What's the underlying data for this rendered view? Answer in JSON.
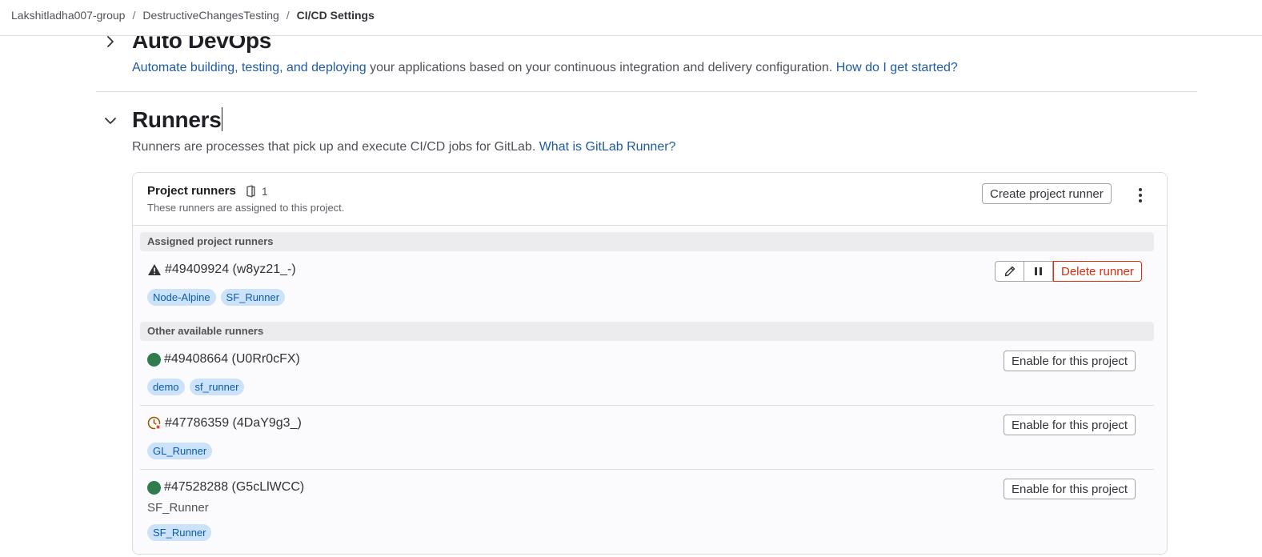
{
  "breadcrumb": {
    "items": [
      "Lakshitladha007-group",
      "DestructiveChangesTesting",
      "CI/CD Settings"
    ],
    "separator": "/"
  },
  "auto_devops": {
    "title": "Auto DevOps",
    "desc_link": "Automate building, testing, and deploying",
    "desc_text": " your applications based on your continuous integration and delivery configuration. ",
    "help_link": "How do I get started?"
  },
  "runners": {
    "title": "Runners",
    "desc_text": "Runners are processes that pick up and execute CI/CD jobs for GitLab. ",
    "help_link": "What is GitLab Runner?"
  },
  "project_runners": {
    "title": "Project runners",
    "count": "1",
    "subtitle": "These runners are assigned to this project.",
    "create_button": "Create project runner",
    "assigned_header": "Assigned project runners",
    "assigned": [
      {
        "name": "#49409924 (w8yz21_-)",
        "status": "warning-icon",
        "tags": [
          "Node-Alpine",
          "SF_Runner"
        ],
        "delete_button": "Delete runner"
      }
    ],
    "other_header": "Other available runners",
    "enable_label": "Enable for this project",
    "other": [
      {
        "name": "#49408664 (U0Rr0cFX)",
        "status": "online",
        "description": "",
        "tags": [
          "demo",
          "sf_runner"
        ]
      },
      {
        "name": "#47786359 (4DaY9g3_)",
        "status": "stale",
        "description": "",
        "tags": [
          "GL_Runner"
        ]
      },
      {
        "name": "#47528288 (G5cLlWCC)",
        "status": "online",
        "description": "SF_Runner",
        "tags": [
          "SF_Runner"
        ]
      }
    ]
  },
  "colors": {
    "link": "#1f5aa6",
    "online": "#2f7d4c",
    "stale": "#9e5400",
    "danger": "#dd2b0e",
    "tag_bg": "#cbe2f9",
    "tag_text": "#0b5cad"
  }
}
